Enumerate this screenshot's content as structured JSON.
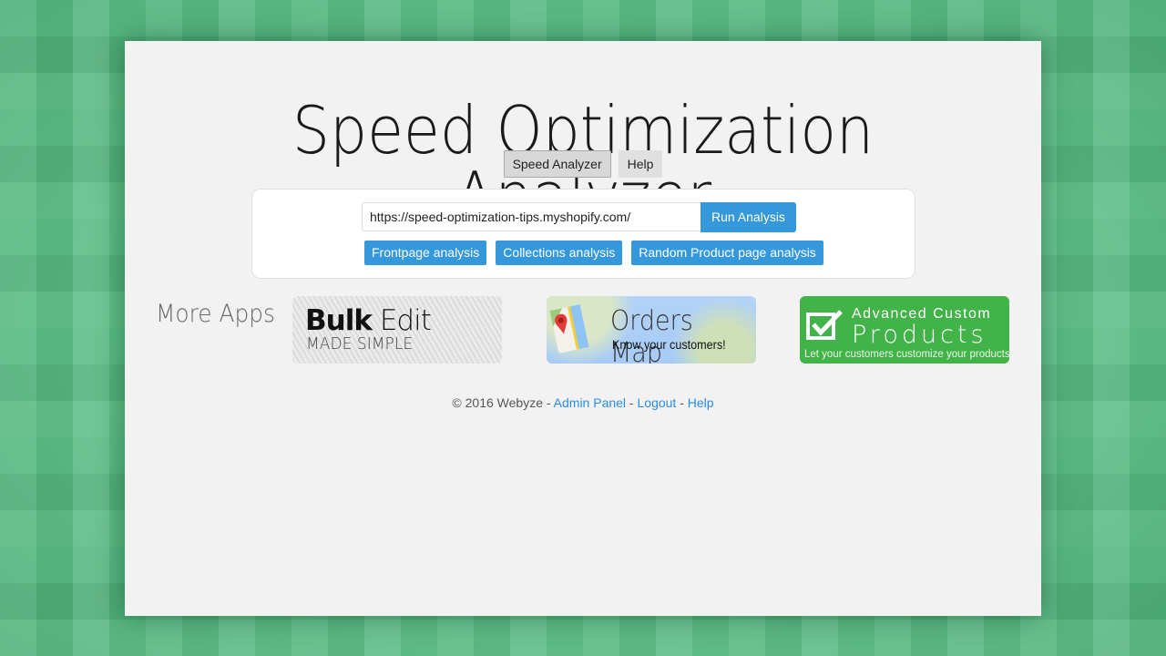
{
  "app": {
    "title": "Speed Optimization Analyzer"
  },
  "nav": {
    "items": [
      {
        "label": "Speed Analyzer",
        "active": true
      },
      {
        "label": "Help",
        "active": false
      }
    ]
  },
  "analyzer": {
    "url_value": "https://speed-optimization-tips.myshopify.com/",
    "run_label": "Run Analysis",
    "types": [
      {
        "label": "Frontpage analysis"
      },
      {
        "label": "Collections analysis"
      },
      {
        "label": "Random Product page analysis"
      }
    ]
  },
  "more_apps": {
    "label": "More Apps",
    "apps": [
      {
        "name": "Bulk Edit",
        "title_bold": "Bulk",
        "title_light": "Edit",
        "subtitle": "MADE SIMPLE"
      },
      {
        "name": "Orders Map",
        "title": "Orders Map",
        "subtitle": "Know your customers!"
      },
      {
        "name": "Advanced Custom Products",
        "line1": "Advanced Custom",
        "line2": "Products",
        "tagline": "Let your customers customize your products."
      }
    ]
  },
  "footer": {
    "copyright": "© 2016 Webyze - ",
    "sep": " - ",
    "links": [
      {
        "label": "Admin Panel"
      },
      {
        "label": "Logout"
      },
      {
        "label": "Help"
      }
    ]
  },
  "colors": {
    "accent": "#3498db",
    "link": "#2a8de0",
    "acp_green": "#42b348",
    "background_green": "#5cc488"
  }
}
